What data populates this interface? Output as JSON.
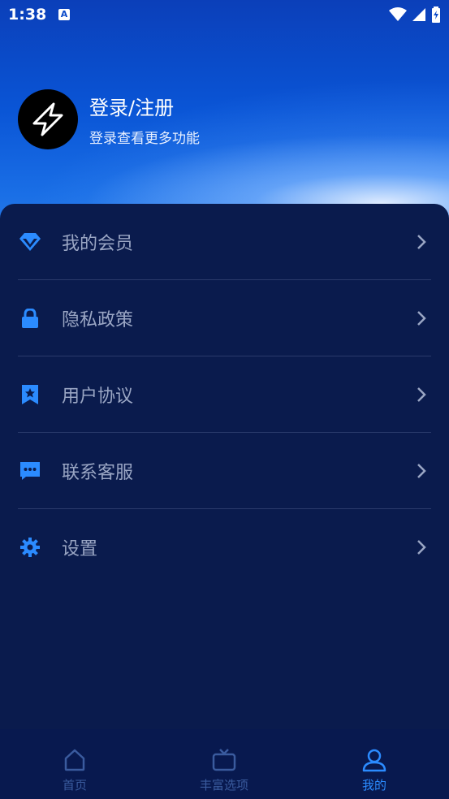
{
  "status_bar": {
    "time": "1:38",
    "app_badge": "A"
  },
  "profile": {
    "title": "登录/注册",
    "subtitle": "登录查看更多功能"
  },
  "menu": {
    "items": [
      {
        "label": "我的会员",
        "icon": "diamond-icon"
      },
      {
        "label": "隐私政策",
        "icon": "lock-icon"
      },
      {
        "label": "用户协议",
        "icon": "bookmark-star-icon"
      },
      {
        "label": "联系客服",
        "icon": "chat-icon"
      },
      {
        "label": "设置",
        "icon": "gear-icon"
      }
    ]
  },
  "tabbar": {
    "tabs": [
      {
        "label": "首页",
        "icon": "home-icon",
        "active": false
      },
      {
        "label": "丰富选项",
        "icon": "tv-icon",
        "active": false
      },
      {
        "label": "我的",
        "icon": "user-icon",
        "active": true
      }
    ]
  },
  "colors": {
    "accent": "#2b8bff",
    "panel": "#0a1b4d",
    "tabbar": "#08194f",
    "inactive": "#3a5b9e"
  }
}
